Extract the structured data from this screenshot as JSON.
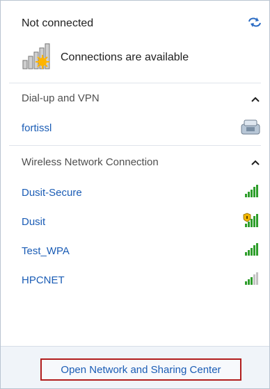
{
  "status": {
    "title": "Not connected",
    "subtitle": "Connections are available"
  },
  "sections": [
    {
      "header": "Dial-up and VPN",
      "items": [
        {
          "label": "fortissl",
          "icon": "vpn-phone-icon"
        }
      ]
    },
    {
      "header": "Wireless Network Connection",
      "items": [
        {
          "label": "Dusit-Secure",
          "signal": 5,
          "secured": true
        },
        {
          "label": "Dusit",
          "signal": 5,
          "shield": true
        },
        {
          "label": "Test_WPA",
          "signal": 5,
          "secured": true
        },
        {
          "label": "HPCNET",
          "signal": 3,
          "secured": true
        }
      ]
    }
  ],
  "footer": {
    "link": "Open Network and Sharing Center"
  },
  "colors": {
    "link": "#1a5cb5",
    "highlight_border": "#b11c1c",
    "signal": "#2e9e2b"
  }
}
